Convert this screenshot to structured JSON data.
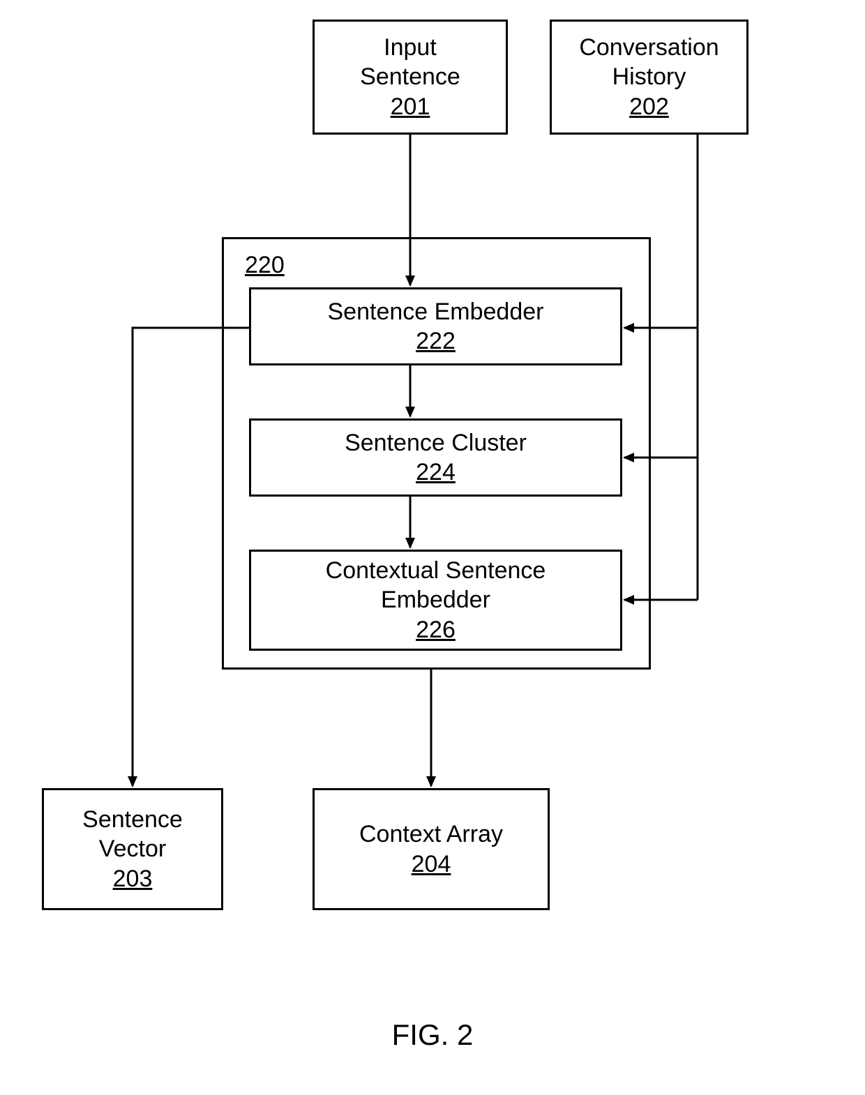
{
  "boxes": {
    "input_sentence": {
      "label": "Input\nSentence",
      "ref": "201"
    },
    "conversation_history": {
      "label": "Conversation\nHistory",
      "ref": "202"
    },
    "sentence_embedder": {
      "label": "Sentence Embedder",
      "ref": "222"
    },
    "sentence_cluster": {
      "label": "Sentence Cluster",
      "ref": "224"
    },
    "contextual_embedder": {
      "label": "Contextual Sentence\nEmbedder",
      "ref": "226"
    },
    "sentence_vector": {
      "label": "Sentence\nVector",
      "ref": "203"
    },
    "context_array": {
      "label": "Context Array",
      "ref": "204"
    }
  },
  "container": {
    "ref": "220"
  },
  "figure_caption": "FIG. 2"
}
